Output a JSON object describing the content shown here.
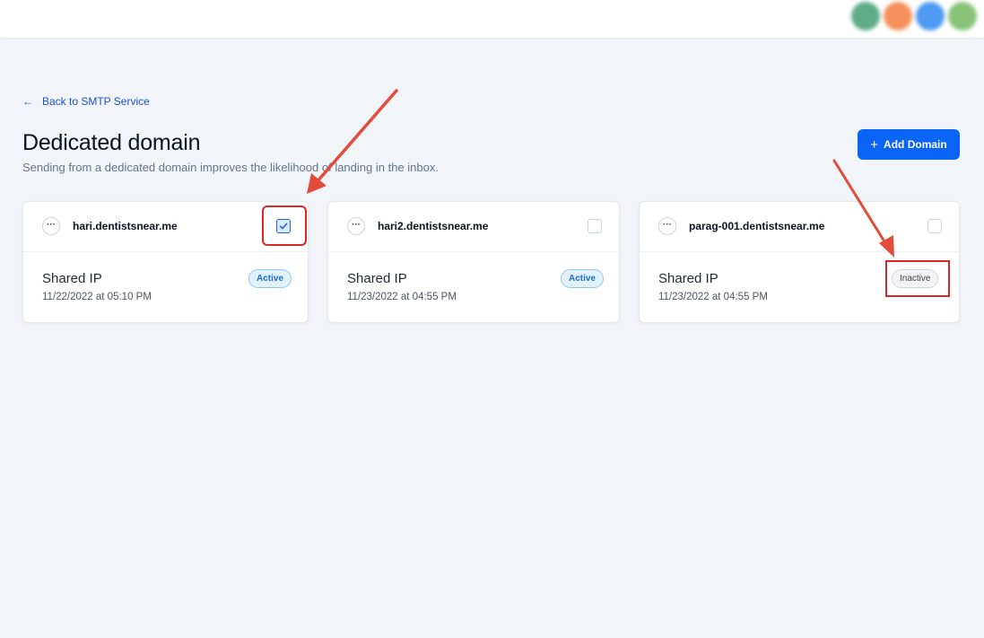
{
  "back_link": {
    "label": "Back to SMTP Service"
  },
  "page": {
    "title": "Dedicated domain",
    "subtitle": "Sending from a dedicated domain improves the likelihood of landing in the inbox."
  },
  "add_button": {
    "label": "Add Domain"
  },
  "avatar_colors": [
    "#4fa37e",
    "#f5854b",
    "#3b8ef0",
    "#7cbd6b"
  ],
  "cards": [
    {
      "domain": "hari.dentistsnear.me",
      "checked": true,
      "ip_type": "Shared IP",
      "date": "11/22/2022 at 05:10 PM",
      "status": "Active"
    },
    {
      "domain": "hari2.dentistsnear.me",
      "checked": false,
      "ip_type": "Shared IP",
      "date": "11/23/2022 at 04:55 PM",
      "status": "Active"
    },
    {
      "domain": "parag-001.dentistsnear.me",
      "checked": false,
      "ip_type": "Shared IP",
      "date": "11/23/2022 at 04:55 PM",
      "status": "Inactive"
    }
  ],
  "more_icon_text": "···",
  "colors": {
    "primary": "#0a64f5",
    "annotation": "#e24c3a"
  }
}
